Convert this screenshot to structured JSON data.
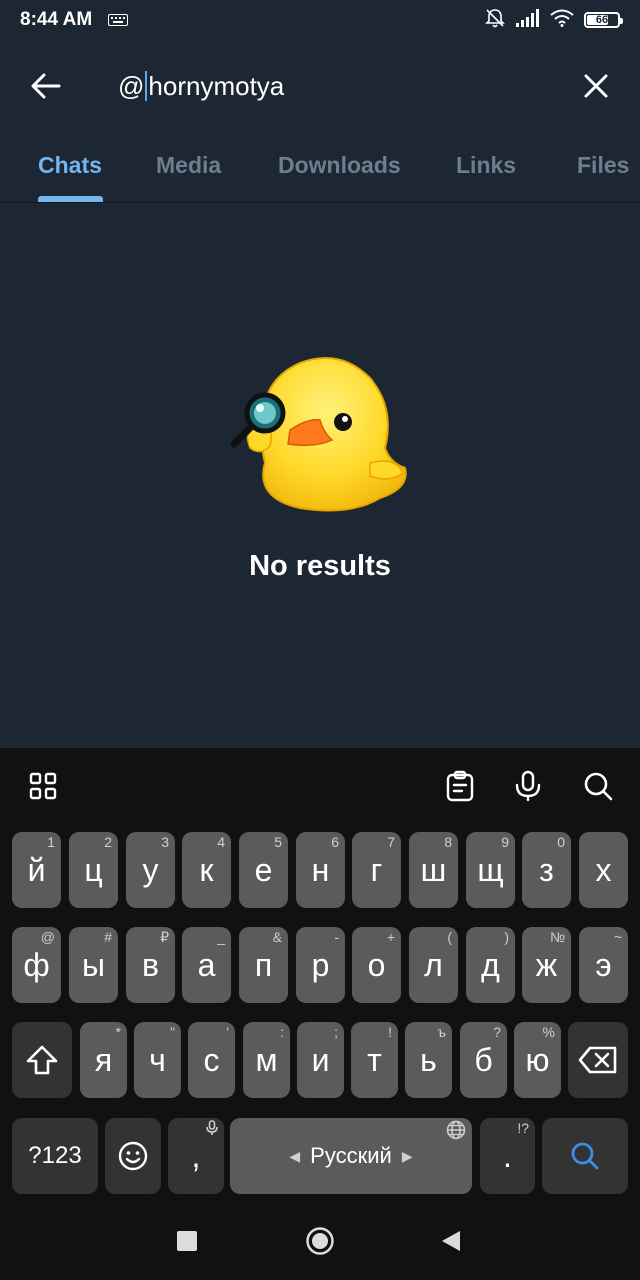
{
  "status": {
    "time": "8:44 AM",
    "battery": "66"
  },
  "search": {
    "prefix": "@",
    "suffix": "hornymotya"
  },
  "tabs": [
    {
      "label": "Chats",
      "active": true
    },
    {
      "label": "Media",
      "active": false
    },
    {
      "label": "Downloads",
      "active": false
    },
    {
      "label": "Links",
      "active": false
    },
    {
      "label": "Files",
      "active": false
    }
  ],
  "empty_state": {
    "message": "No results"
  },
  "keyboard": {
    "row1": [
      {
        "key": "й",
        "sup": "1"
      },
      {
        "key": "ц",
        "sup": "2"
      },
      {
        "key": "у",
        "sup": "3"
      },
      {
        "key": "к",
        "sup": "4"
      },
      {
        "key": "е",
        "sup": "5"
      },
      {
        "key": "н",
        "sup": "6"
      },
      {
        "key": "г",
        "sup": "7"
      },
      {
        "key": "ш",
        "sup": "8"
      },
      {
        "key": "щ",
        "sup": "9"
      },
      {
        "key": "з",
        "sup": "0"
      },
      {
        "key": "х",
        "sup": ""
      }
    ],
    "row2": [
      {
        "key": "ф",
        "sup": "@"
      },
      {
        "key": "ы",
        "sup": "#"
      },
      {
        "key": "в",
        "sup": "₽"
      },
      {
        "key": "а",
        "sup": "_"
      },
      {
        "key": "п",
        "sup": "&"
      },
      {
        "key": "р",
        "sup": "-"
      },
      {
        "key": "о",
        "sup": "+"
      },
      {
        "key": "л",
        "sup": "("
      },
      {
        "key": "д",
        "sup": ")"
      },
      {
        "key": "ж",
        "sup": "№"
      },
      {
        "key": "э",
        "sup": "~"
      }
    ],
    "row3": [
      {
        "key": "я",
        "sup": "*"
      },
      {
        "key": "ч",
        "sup": "\""
      },
      {
        "key": "с",
        "sup": "'"
      },
      {
        "key": "м",
        "sup": ":"
      },
      {
        "key": "и",
        "sup": ";"
      },
      {
        "key": "т",
        "sup": "!"
      },
      {
        "key": "ь",
        "sup": "ъ"
      },
      {
        "key": "б",
        "sup": "?"
      },
      {
        "key": "ю",
        "sup": "%"
      }
    ],
    "symbols_label": "?123",
    "comma": ",",
    "space_label": "Русский",
    "period": ".",
    "period_sup": "!?"
  },
  "colors": {
    "background": "#1d2733",
    "accent": "#72b6ee",
    "keyboard_bg": "#111111",
    "key": "#5b5b5b",
    "search_key_icon": "#3d8fe6"
  }
}
